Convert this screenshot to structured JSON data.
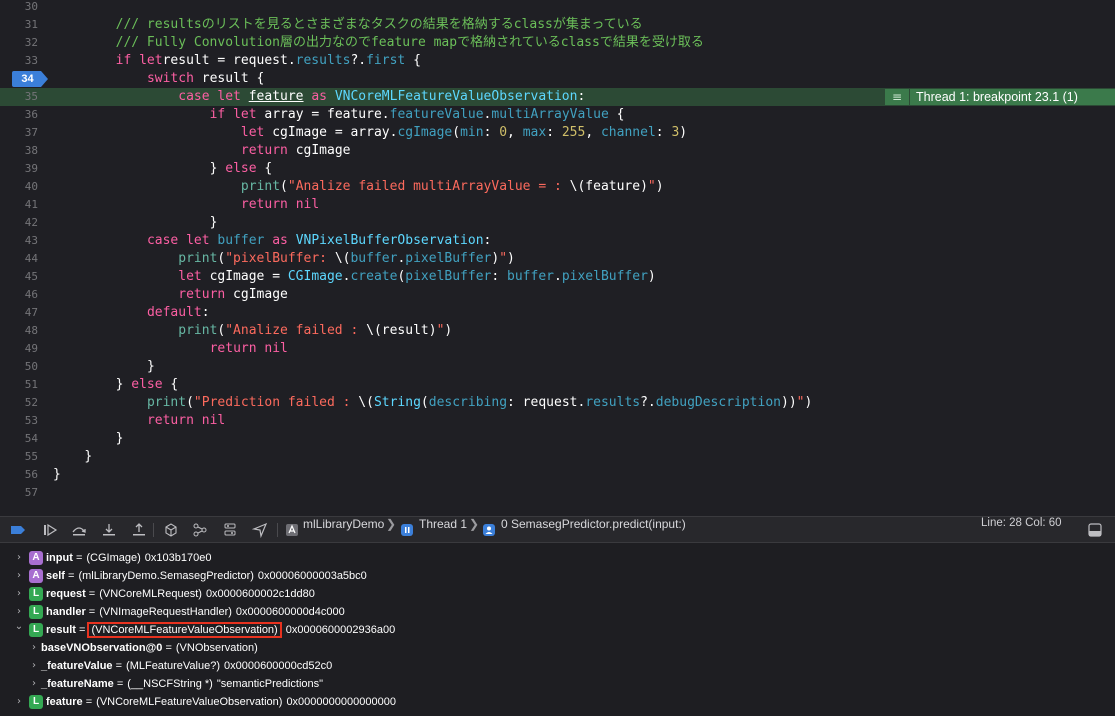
{
  "editor": {
    "breakpoint_label": "Thread 1: breakpoint 23.1 (1)",
    "lines": [
      {
        "n": "30",
        "ind": 0,
        "s": []
      },
      {
        "n": "31",
        "ind": 2,
        "s": [
          [
            "cm",
            "/// resultsのリストを見るとさまざまなタスクの結果を格納するclassが集まっている"
          ]
        ]
      },
      {
        "n": "32",
        "ind": 2,
        "s": [
          [
            "cm",
            "/// Fully Convolution層の出力なのでfeature mapで格納されているclassで結果を受け取る"
          ]
        ]
      },
      {
        "n": "33",
        "ind": 2,
        "s": [
          [
            "kw",
            "if let"
          ],
          [
            "",
            "result = request."
          ],
          [
            "me",
            "results"
          ],
          [
            "",
            "?."
          ],
          [
            "me",
            "first"
          ],
          [
            "",
            " {"
          ]
        ]
      },
      {
        "n": "34",
        "ind": 3,
        "bp": true,
        "s": [
          [
            "kw",
            "switch"
          ],
          [
            "",
            " result {"
          ]
        ]
      },
      {
        "n": "35",
        "ind": 4,
        "hl": true,
        "s": [
          [
            "kw",
            "case let"
          ],
          [
            "",
            " "
          ],
          [
            "u",
            "feature"
          ],
          [
            "",
            " "
          ],
          [
            "kw",
            "as"
          ],
          [
            "",
            " "
          ],
          [
            "ty",
            "VNCoreMLFeatureValueObservation"
          ],
          [
            "",
            ":"
          ]
        ]
      },
      {
        "n": "36",
        "ind": 5,
        "s": [
          [
            "kw",
            "if let"
          ],
          [
            "",
            " array = feature."
          ],
          [
            "me",
            "featureValue"
          ],
          [
            "",
            "."
          ],
          [
            "me",
            "multiArrayValue"
          ],
          [
            "",
            " {"
          ]
        ]
      },
      {
        "n": "37",
        "ind": 6,
        "s": [
          [
            "kw",
            "let"
          ],
          [
            "",
            " cgImage = array."
          ],
          [
            "me",
            "cgImage"
          ],
          [
            "",
            "("
          ],
          [
            "me",
            "min"
          ],
          [
            "",
            ": "
          ],
          [
            "nu",
            "0"
          ],
          [
            "",
            ", "
          ],
          [
            "me",
            "max"
          ],
          [
            "",
            ": "
          ],
          [
            "nu",
            "255"
          ],
          [
            "",
            ", "
          ],
          [
            "me",
            "channel"
          ],
          [
            "",
            ": "
          ],
          [
            "nu",
            "3"
          ],
          [
            "",
            ")"
          ]
        ]
      },
      {
        "n": "38",
        "ind": 6,
        "s": [
          [
            "kw",
            "return"
          ],
          [
            "",
            " cgImage"
          ]
        ]
      },
      {
        "n": "39",
        "ind": 5,
        "s": [
          [
            "",
            "} "
          ],
          [
            "kw",
            "else"
          ],
          [
            "",
            " {"
          ]
        ]
      },
      {
        "n": "40",
        "ind": 6,
        "s": [
          [
            "fn",
            "print"
          ],
          [
            "",
            "("
          ],
          [
            "st",
            "\"Analize failed multiArrayValue = : "
          ],
          [
            "",
            "\\(feature)"
          ],
          [
            "st",
            "\""
          ],
          [
            "",
            ")"
          ]
        ]
      },
      {
        "n": "41",
        "ind": 6,
        "s": [
          [
            "kw",
            "return nil"
          ]
        ]
      },
      {
        "n": "42",
        "ind": 5,
        "s": [
          [
            "",
            "}"
          ]
        ]
      },
      {
        "n": "43",
        "ind": 3,
        "s": [
          [
            "kw",
            "case let"
          ],
          [
            "",
            " "
          ],
          [
            "me",
            "buffer"
          ],
          [
            "",
            " "
          ],
          [
            "kw",
            "as"
          ],
          [
            "",
            " "
          ],
          [
            "ty",
            "VNPixelBufferObservation"
          ],
          [
            "",
            ":"
          ]
        ]
      },
      {
        "n": "44",
        "ind": 4,
        "s": [
          [
            "fn",
            "print"
          ],
          [
            "",
            "("
          ],
          [
            "st",
            "\"pixelBuffer: "
          ],
          [
            "",
            "\\("
          ],
          [
            "me",
            "buffer"
          ],
          [
            "",
            "."
          ],
          [
            "me",
            "pixelBuffer"
          ],
          [
            "",
            ")"
          ],
          [
            "st",
            "\""
          ],
          [
            "",
            ")"
          ]
        ]
      },
      {
        "n": "45",
        "ind": 4,
        "s": [
          [
            "kw",
            "let"
          ],
          [
            "",
            " cgImage = "
          ],
          [
            "ty",
            "CGImage"
          ],
          [
            "",
            "."
          ],
          [
            "me",
            "create"
          ],
          [
            "",
            "("
          ],
          [
            "me",
            "pixelBuffer"
          ],
          [
            "",
            ": "
          ],
          [
            "me",
            "buffer"
          ],
          [
            "",
            "."
          ],
          [
            "me",
            "pixelBuffer"
          ],
          [
            "",
            ")"
          ]
        ]
      },
      {
        "n": "46",
        "ind": 4,
        "s": [
          [
            "kw",
            "return"
          ],
          [
            "",
            " cgImage"
          ]
        ]
      },
      {
        "n": "47",
        "ind": 3,
        "s": [
          [
            "kw",
            "default"
          ],
          [
            "",
            ":"
          ]
        ]
      },
      {
        "n": "48",
        "ind": 4,
        "s": [
          [
            "fn",
            "print"
          ],
          [
            "",
            "("
          ],
          [
            "st",
            "\"Analize failed : "
          ],
          [
            "",
            "\\(result)"
          ],
          [
            "st",
            "\""
          ],
          [
            "",
            ")"
          ]
        ]
      },
      {
        "n": "49",
        "ind": 5,
        "s": [
          [
            "kw",
            "return nil"
          ]
        ]
      },
      {
        "n": "50",
        "ind": 3,
        "s": [
          [
            "",
            "}"
          ]
        ]
      },
      {
        "n": "51",
        "ind": 2,
        "s": [
          [
            "",
            "} "
          ],
          [
            "kw",
            "else"
          ],
          [
            "",
            " {"
          ]
        ]
      },
      {
        "n": "52",
        "ind": 3,
        "s": [
          [
            "fn",
            "print"
          ],
          [
            "",
            "("
          ],
          [
            "st",
            "\"Prediction failed : "
          ],
          [
            "",
            "\\("
          ],
          [
            "ty",
            "String"
          ],
          [
            "",
            "("
          ],
          [
            "me",
            "describing"
          ],
          [
            "",
            ": request."
          ],
          [
            "me",
            "results"
          ],
          [
            "",
            "?."
          ],
          [
            "me",
            "debugDescription"
          ],
          [
            "",
            "))"
          ],
          [
            "st",
            "\""
          ],
          [
            "",
            ")"
          ]
        ]
      },
      {
        "n": "53",
        "ind": 3,
        "s": [
          [
            "kw",
            "return nil"
          ]
        ]
      },
      {
        "n": "54",
        "ind": 2,
        "s": [
          [
            "",
            "}"
          ]
        ]
      },
      {
        "n": "55",
        "ind": 1,
        "s": [
          [
            "",
            "}"
          ]
        ]
      },
      {
        "n": "56",
        "ind": 0,
        "s": [
          [
            "",
            "}"
          ]
        ]
      },
      {
        "n": "57",
        "ind": 0,
        "s": []
      }
    ]
  },
  "toolbar": {
    "breadcrumb": {
      "project": "mlLibraryDemo",
      "thread": "Thread 1",
      "frame": "0 SemasegPredictor.predict(input:)"
    },
    "line_col": "Line: 28  Col: 60"
  },
  "variables": [
    {
      "depth": 0,
      "exp": ">",
      "badge": "A",
      "name": "input",
      "type": "(CGImage)",
      "value": "0x103b170e0",
      "boxed": false
    },
    {
      "depth": 0,
      "exp": ">",
      "badge": "A",
      "name": "self",
      "type": "(mlLibraryDemo.SemasegPredictor)",
      "value": "0x00006000003a5bc0",
      "boxed": false
    },
    {
      "depth": 0,
      "exp": ">",
      "badge": "L",
      "name": "request",
      "type": "(VNCoreMLRequest)",
      "value": "0x0000600002c1dd80",
      "boxed": false
    },
    {
      "depth": 0,
      "exp": ">",
      "badge": "L",
      "name": "handler",
      "type": "(VNImageRequestHandler)",
      "value": "0x0000600000d4c000",
      "boxed": false
    },
    {
      "depth": 0,
      "exp": "v",
      "badge": "L",
      "name": "result",
      "type": "(VNCoreMLFeatureValueObservation)",
      "value": "0x0000600002936a00",
      "boxed": true
    },
    {
      "depth": 1,
      "exp": ">",
      "badge": "",
      "name": "baseVNObservation@0",
      "type": "(VNObservation)",
      "value": "",
      "boxed": false
    },
    {
      "depth": 1,
      "exp": ">",
      "badge": "",
      "name": "_featureValue",
      "type": "(MLFeatureValue?)",
      "value": "0x0000600000cd52c0",
      "boxed": false
    },
    {
      "depth": 1,
      "exp": ">",
      "badge": "",
      "name": "_featureName",
      "type": "(__NSCFString *)",
      "value": "\"semanticPredictions\"",
      "boxed": false
    },
    {
      "depth": 0,
      "exp": ">",
      "badge": "L",
      "name": "feature",
      "type": "(VNCoreMLFeatureValueObservation)",
      "value": "0x0000000000000000",
      "boxed": false
    }
  ],
  "colors": {
    "editor_bg": "#1f1f24",
    "keyword": "#fc5fa3",
    "comment": "#6bbf59",
    "string": "#fc6a5d",
    "type": "#5dd8ff",
    "number": "#d0bf69",
    "function": "#67b7a4",
    "member": "#41a1c0",
    "breakpoint": "#3b7fd9",
    "highlight_line": "#2c4a35",
    "breakpoint_banner": "#3b7a4b",
    "badge_argument": "#a86fd0",
    "badge_local": "#34a853",
    "red_outline": "#e8321f"
  },
  "icons": [
    "breakpoint-toggle-icon",
    "continue-icon",
    "step-over-icon",
    "step-into-icon",
    "step-out-icon",
    "view-hierarchy-icon",
    "memory-graph-icon",
    "environment-overrides-icon",
    "location-icon",
    "project-icon",
    "thread-icon",
    "stack-frame-icon",
    "console-toggle-icon"
  ]
}
